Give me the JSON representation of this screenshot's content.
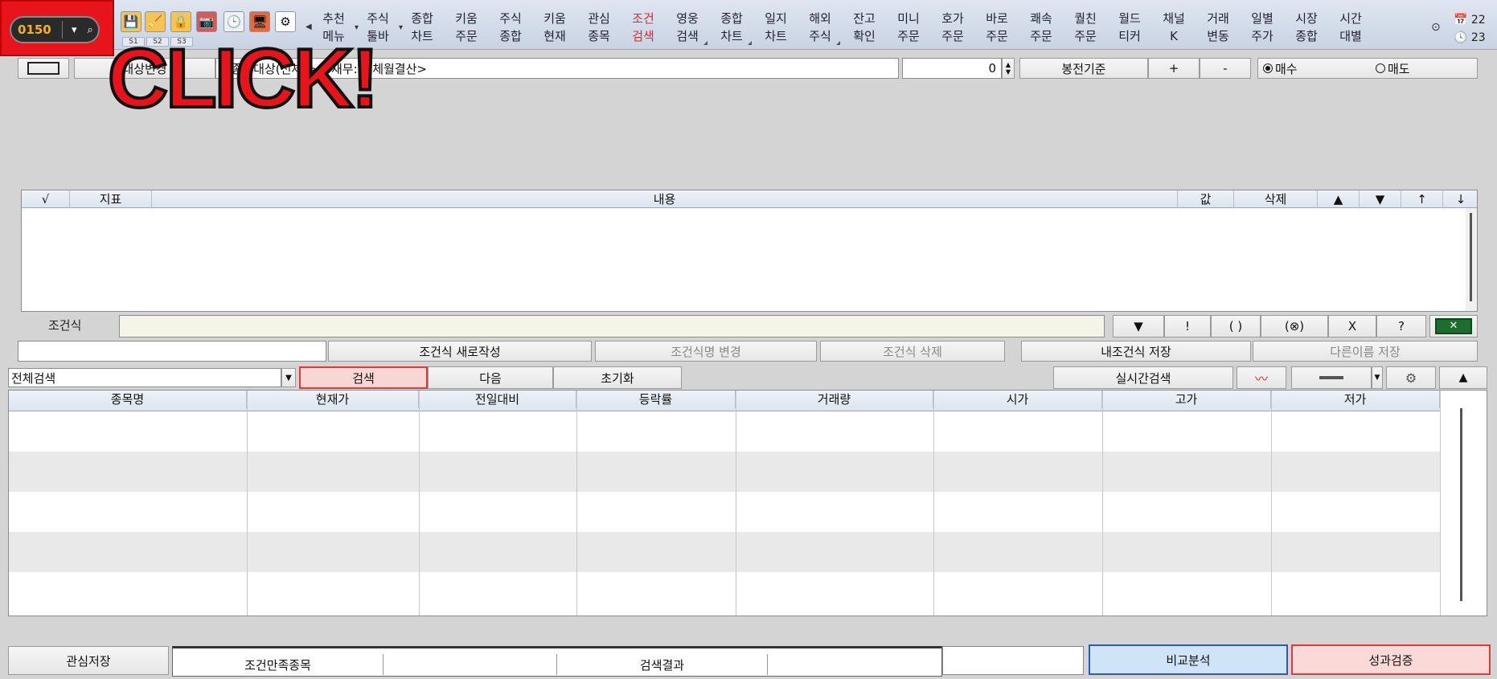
{
  "toolbar": {
    "code_value": "0150",
    "dropdown_glyph": "▾",
    "search_glyph": "🔍",
    "s_labels": [
      "S1",
      "S2",
      "S3"
    ],
    "icons": [
      {
        "name": "save-icon",
        "glyph": "💾"
      },
      {
        "name": "broom-icon",
        "glyph": "🧹"
      },
      {
        "name": "lock-icon",
        "glyph": "🔒"
      },
      {
        "name": "camera-icon",
        "glyph": "📷"
      },
      {
        "name": "clock-icon",
        "glyph": "🕒"
      },
      {
        "name": "monitor-icon",
        "glyph": "🖥"
      },
      {
        "name": "gear-icon",
        "glyph": "⚙"
      }
    ],
    "menu": [
      {
        "top": "추천",
        "bottom": "메뉴"
      },
      {
        "top": "주식",
        "bottom": "툴바"
      },
      {
        "top": "종합",
        "bottom": "차트"
      },
      {
        "top": "키움",
        "bottom": "주문"
      },
      {
        "top": "주식",
        "bottom": "종합"
      },
      {
        "top": "키움",
        "bottom": "현재"
      },
      {
        "top": "관심",
        "bottom": "종목"
      },
      {
        "top": "조건",
        "bottom": "검색"
      },
      {
        "top": "영웅",
        "bottom": "검색"
      },
      {
        "top": "종합",
        "bottom": "차트"
      },
      {
        "top": "일지",
        "bottom": "차트"
      },
      {
        "top": "해외",
        "bottom": "주식"
      },
      {
        "top": "잔고",
        "bottom": "확인"
      },
      {
        "top": "미니",
        "bottom": "주문"
      },
      {
        "top": "호가",
        "bottom": "주문"
      },
      {
        "top": "바로",
        "bottom": "주문"
      },
      {
        "top": "쾌속",
        "bottom": "주문"
      },
      {
        "top": "퀄친",
        "bottom": "주문"
      },
      {
        "top": "월드",
        "bottom": "티커"
      },
      {
        "top": "채널",
        "bottom": "K"
      },
      {
        "top": "거래",
        "bottom": "변동"
      },
      {
        "top": "일별",
        "bottom": "주가"
      },
      {
        "top": "시장",
        "bottom": "종합"
      },
      {
        "top": "시간",
        "bottom": "대별"
      }
    ],
    "active_menu_index": 7,
    "active_color": "#e8262c",
    "date_text": "22",
    "time_text": "23"
  },
  "overlay": {
    "text": "CLICK!"
  },
  "condition_bar": {
    "target_change_label": "대상변경",
    "target_text": "<종목대상(전체)> <재무: 전체월결산>",
    "target_left_fragment": "<",
    "quantity_value": "0",
    "candle_basis_label": "봉전기준",
    "plus_label": "+",
    "minus_label": "-",
    "buy_label": "매수",
    "sell_label": "매도",
    "buy_selected": true
  },
  "indicator_grid": {
    "headers": [
      "√",
      "지표",
      "내용",
      "값",
      "삭제",
      "▲",
      "▼",
      "↑",
      "↓"
    ]
  },
  "formula": {
    "label": "조건식",
    "value": "",
    "ops": [
      "▼",
      "!",
      "( )",
      "(⊗)",
      "X",
      "?"
    ],
    "excel_icon": "excel-icon"
  },
  "actions": {
    "name_value": "",
    "new_label": "조건식 새로작성",
    "rename_label": "조건식명 변경",
    "delete_label": "조건식 삭제",
    "save_label": "내조건식 저장",
    "save_as_label": "다른이름 저장"
  },
  "search_bar": {
    "scope_value": "전체검색",
    "search_label": "검색",
    "next_label": "다음",
    "reset_label": "초기화",
    "realtime_label": "실시간검색",
    "search_highlight": "#f9d6d6"
  },
  "results": {
    "headers": [
      "종목명",
      "현재가",
      "전일대비",
      "등락률",
      "거래량",
      "시가",
      "고가",
      "저가"
    ],
    "rows": 5
  },
  "bottom": {
    "watch_save_label": "관심저장",
    "tab_satisfied": "조건만족종목",
    "tab_empty1": "",
    "tab_result": "검색결과",
    "tab_empty2": "",
    "compare_label": "비교분석",
    "verify_label": "성과검증",
    "compare_color": "#cfe4f6",
    "verify_color": "#fbd9d9"
  }
}
